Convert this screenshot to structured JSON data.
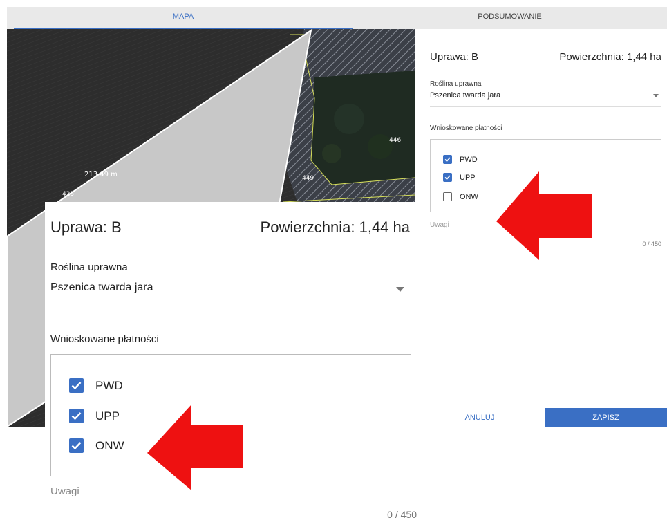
{
  "tabs": [
    {
      "label": "MAPA",
      "active": true
    },
    {
      "label": "PODSUMOWANIE",
      "active": false
    }
  ],
  "map": {
    "labels": [
      "446",
      "449",
      "425"
    ],
    "measurement": "213.49 m"
  },
  "panel_small": {
    "title": "Uprawa: B",
    "area": "Powierzchnia: 1,44 ha",
    "crop_label": "Roślina uprawna",
    "crop_value": "Pszenica twarda jara",
    "payments_label": "Wnioskowane płatności",
    "payments": [
      {
        "label": "PWD",
        "checked": true
      },
      {
        "label": "UPP",
        "checked": true
      },
      {
        "label": "ONW",
        "checked": false
      }
    ],
    "notes_placeholder": "Uwagi",
    "counter": "0 / 450",
    "cancel_label": "ANULUJ",
    "save_label": "ZAPISZ"
  },
  "panel_zoom": {
    "title": "Uprawa: B",
    "area": "Powierzchnia: 1,44 ha",
    "crop_label": "Roślina uprawna",
    "crop_value": "Pszenica twarda jara",
    "payments_label": "Wnioskowane płatności",
    "payments": [
      {
        "label": "PWD",
        "checked": true
      },
      {
        "label": "UPP",
        "checked": true
      },
      {
        "label": "ONW",
        "checked": true
      }
    ],
    "notes_placeholder": "Uwagi",
    "counter": "0 / 450"
  },
  "colors": {
    "accent": "#3a6fc4",
    "arrow": "#ee1111"
  }
}
